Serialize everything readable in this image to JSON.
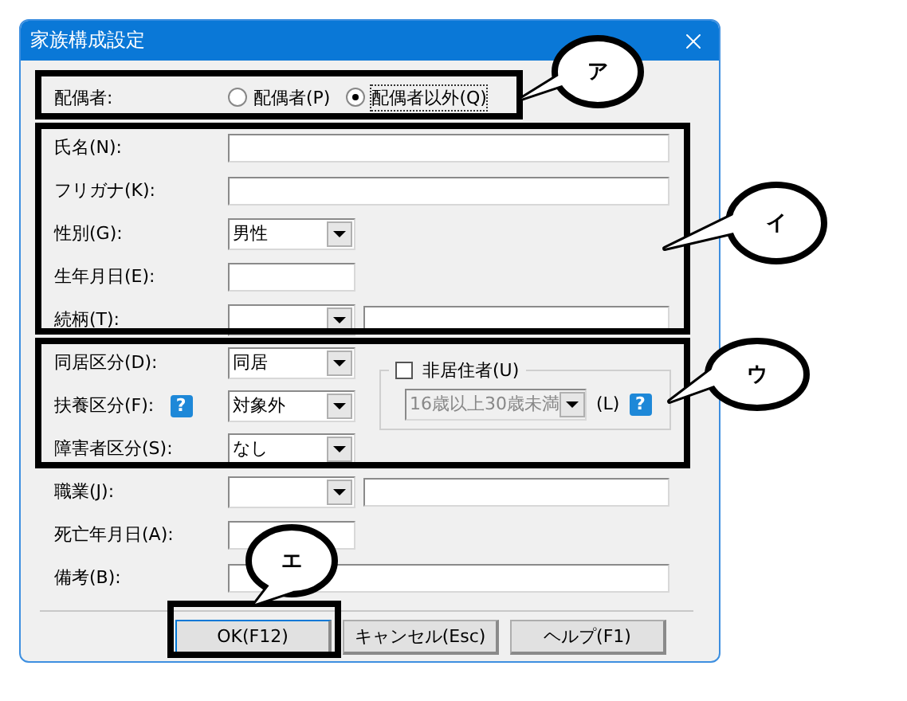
{
  "window": {
    "title": "家族構成設定"
  },
  "spouse": {
    "label": "配偶者:",
    "options": [
      {
        "label": "配偶者(P)",
        "selected": false
      },
      {
        "label": "配偶者以外(Q)",
        "selected": true
      }
    ]
  },
  "personal": [
    {
      "kind": "text",
      "label": "氏名(N):"
    },
    {
      "kind": "text",
      "label": "フリガナ(K):"
    },
    {
      "kind": "combo",
      "label": "性別(G):",
      "value": "男性"
    },
    {
      "kind": "date",
      "label": "生年月日(E):"
    },
    {
      "kind": "combo_text",
      "label": "続柄(T):"
    }
  ],
  "status": [
    {
      "kind": "combo",
      "label": "同居区分(D):",
      "value": "同居"
    },
    {
      "kind": "combo",
      "label": "扶養区分(F):",
      "value": "対象外",
      "help": "?"
    },
    {
      "kind": "combo",
      "label": "障害者区分(S):",
      "value": "なし"
    }
  ],
  "nonresident": {
    "label": "非居住者(U)",
    "checked": false,
    "combo": {
      "value": "16歳以上30歳未満",
      "disabled": true
    },
    "suffix": "(L)",
    "help": "?"
  },
  "other": [
    {
      "kind": "combo_text",
      "label": "職業(J):"
    },
    {
      "kind": "date",
      "label": "死亡年月日(A):"
    },
    {
      "kind": "text",
      "label": "備考(B):"
    }
  ],
  "buttons": [
    {
      "label": "OK(F12)",
      "default": true
    },
    {
      "label": "キャンセル(Esc)",
      "default": false
    },
    {
      "label": "ヘルプ(F1)",
      "default": false
    }
  ],
  "callouts": [
    {
      "label": "ア"
    },
    {
      "label": "イ"
    },
    {
      "label": "ウ"
    },
    {
      "label": "エ"
    }
  ]
}
